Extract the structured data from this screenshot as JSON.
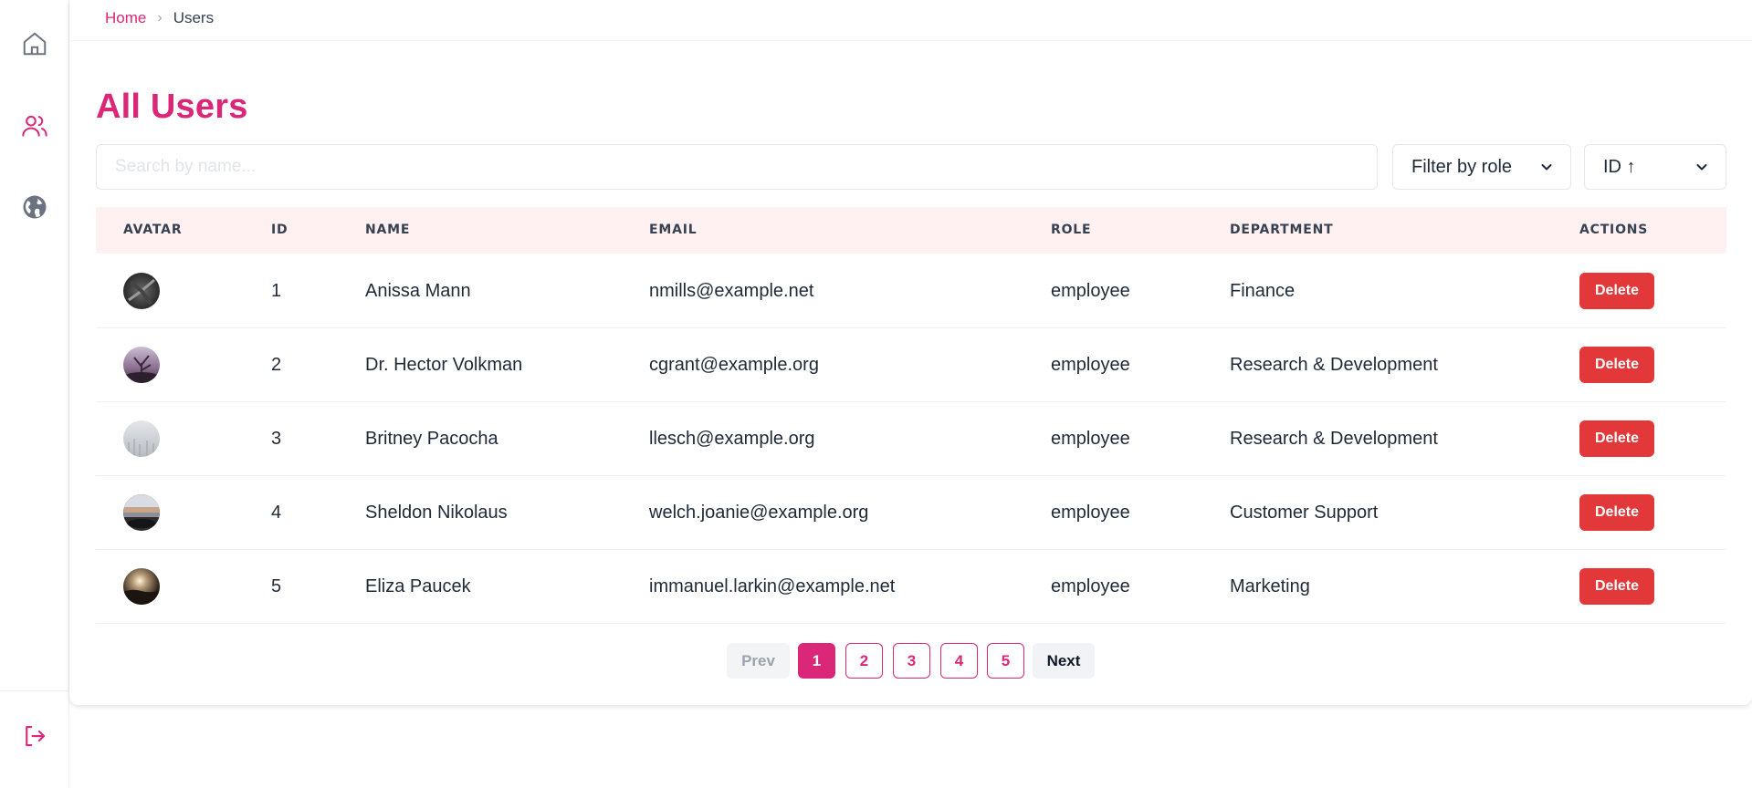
{
  "colors": {
    "accent": "#db2777",
    "danger": "#e3383a",
    "header_bg": "#fff1f2"
  },
  "sidebar": {
    "items": [
      {
        "name": "home",
        "icon": "home-icon"
      },
      {
        "name": "users",
        "icon": "users-icon",
        "active": true
      },
      {
        "name": "globe",
        "icon": "globe-icon"
      }
    ],
    "logout_icon": "logout-icon"
  },
  "breadcrumb": {
    "home": "Home",
    "separator": "›",
    "current": "Users"
  },
  "page_title": "All Users",
  "search": {
    "placeholder": "Search by name...",
    "value": ""
  },
  "filters": {
    "role_label": "Filter by role",
    "sort_label": "ID ↑"
  },
  "table": {
    "columns": [
      "AVATAR",
      "ID",
      "NAME",
      "EMAIL",
      "ROLE",
      "DEPARTMENT",
      "ACTIONS"
    ],
    "rows": [
      {
        "id": "1",
        "name": "Anissa Mann",
        "email": "nmills@example.net",
        "role": "employee",
        "department": "Finance",
        "action": "Delete"
      },
      {
        "id": "2",
        "name": "Dr. Hector Volkman",
        "email": "cgrant@example.org",
        "role": "employee",
        "department": "Research & Development",
        "action": "Delete"
      },
      {
        "id": "3",
        "name": "Britney Pacocha",
        "email": "llesch@example.org",
        "role": "employee",
        "department": "Research & Development",
        "action": "Delete"
      },
      {
        "id": "4",
        "name": "Sheldon Nikolaus",
        "email": "welch.joanie@example.org",
        "role": "employee",
        "department": "Customer Support",
        "action": "Delete"
      },
      {
        "id": "5",
        "name": "Eliza Paucek",
        "email": "immanuel.larkin@example.net",
        "role": "employee",
        "department": "Marketing",
        "action": "Delete"
      }
    ]
  },
  "pagination": {
    "prev": "Prev",
    "pages": [
      "1",
      "2",
      "3",
      "4",
      "5"
    ],
    "current": "1",
    "next": "Next"
  }
}
